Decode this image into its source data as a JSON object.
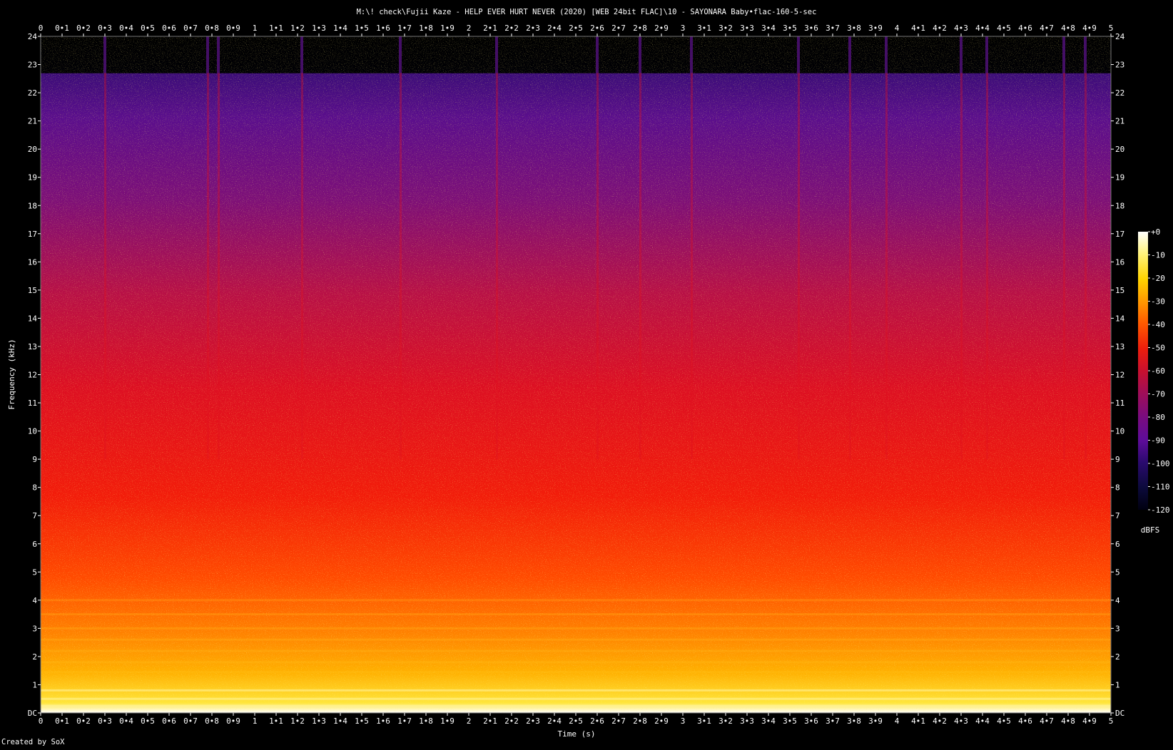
{
  "chart_data": {
    "type": "heatmap",
    "title": "M:\\! check\\Fujii Kaze - HELP EVER HURT NEVER (2020) [WEB 24bit FLAC]\\10 - SAYONARA Baby•flac-160-5-sec",
    "xlabel": "Time (s)",
    "ylabel": "Frequency (kHz)",
    "xlim": [
      0,
      5
    ],
    "ylim": [
      0,
      24
    ],
    "x_ticks": [
      "0",
      "0•1",
      "0•2",
      "0•3",
      "0•4",
      "0•5",
      "0•6",
      "0•7",
      "0•8",
      "0•9",
      "1",
      "1•1",
      "1•2",
      "1•3",
      "1•4",
      "1•5",
      "1•6",
      "1•7",
      "1•8",
      "1•9",
      "2",
      "2•1",
      "2•2",
      "2•3",
      "2•4",
      "2•5",
      "2•6",
      "2•7",
      "2•8",
      "2•9",
      "3",
      "3•1",
      "3•2",
      "3•3",
      "3•4",
      "3•5",
      "3•6",
      "3•7",
      "3•8",
      "3•9",
      "4",
      "4•1",
      "4•2",
      "4•3",
      "4•4",
      "4•5",
      "4•6",
      "4•7",
      "4•8",
      "4•9",
      "5"
    ],
    "y_ticks": [
      "DC",
      "1",
      "2",
      "3",
      "4",
      "5",
      "6",
      "7",
      "8",
      "9",
      "10",
      "11",
      "12",
      "13",
      "14",
      "15",
      "16",
      "17",
      "18",
      "19",
      "20",
      "21",
      "22",
      "23",
      "24"
    ],
    "colorbar": {
      "label": "dBFS",
      "ticks": [
        "+0",
        "-10",
        "-20",
        "-30",
        "-40",
        "-50",
        "-60",
        "-70",
        "-80",
        "-90",
        "-100",
        "-110",
        "-120"
      ],
      "range": [
        0,
        -120
      ]
    },
    "frequency_cutoff_khz": 22.7,
    "gap_times_s": [
      0.3,
      0.78,
      0.83,
      1.22,
      1.68,
      2.13,
      2.6,
      2.8,
      3.04,
      3.54,
      3.78,
      3.95,
      4.3,
      4.42,
      4.78,
      4.88
    ],
    "footer": "Created by SoX"
  },
  "colors": {
    "background": "#000000",
    "text": "#ffffff",
    "colormap": [
      "#ffffff",
      "#fff27a",
      "#ffd400",
      "#ff9900",
      "#ff5a00",
      "#ee1e0c",
      "#c8102e",
      "#8e0c6c",
      "#5e0c9a",
      "#2a0a6e",
      "#0c0a3c",
      "#000010"
    ]
  }
}
